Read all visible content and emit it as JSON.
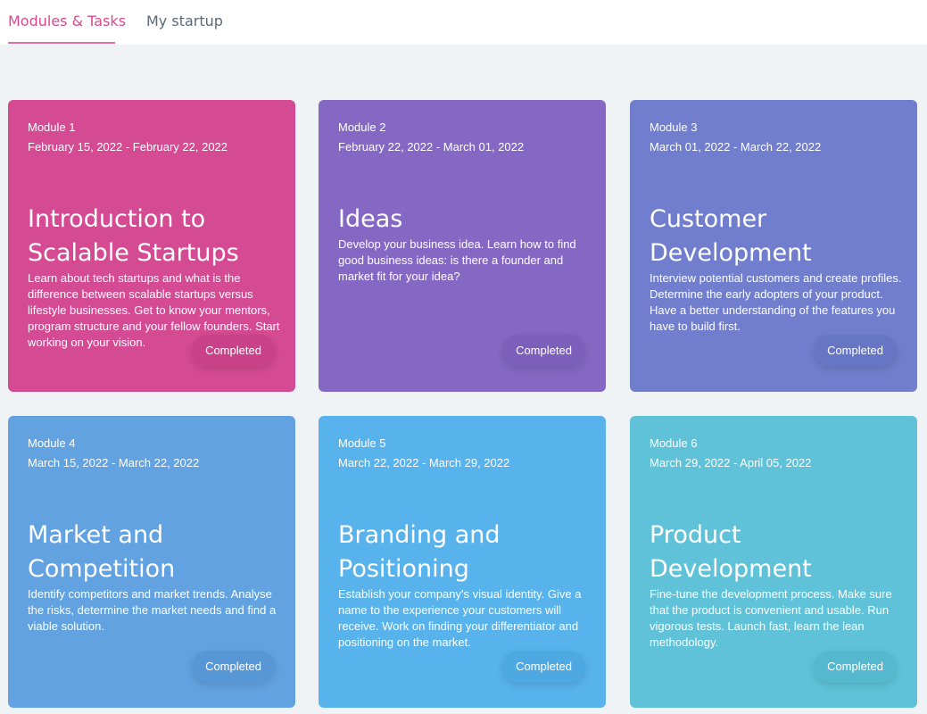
{
  "nav": {
    "tabs": [
      {
        "label": "Modules & Tasks"
      },
      {
        "label": "My startup"
      }
    ]
  },
  "modules": [
    {
      "module": "Module 1",
      "dates": "February 15, 2022 - February 22, 2022",
      "title": "Introduction to Scalable Startups",
      "description": "Learn about tech startups and what is the difference between scalable startups versus lifestyle businesses. Get to know your mentors, program structure and your fellow founders. Start working on your vision.",
      "status": "Completed",
      "color": "#d44a93",
      "badge_color": "#c94289"
    },
    {
      "module": "Module 2",
      "dates": "February 22, 2022 - March 01, 2022",
      "title": "Ideas",
      "description": "Develop your business idea. Learn how to find good business ideas: is there a founder and market fit for your idea?",
      "status": "Completed",
      "color": "#8468c4",
      "badge_color": "#7b5fbb"
    },
    {
      "module": "Module 3",
      "dates": "March 01, 2022 - March 22, 2022",
      "title": "Customer Development",
      "description": "Interview potential customers and create profiles. Determine the early adopters of your product. Have a better understanding of the features you have to build first.",
      "status": "Completed",
      "color": "#707ecd",
      "badge_color": "#6675c4"
    },
    {
      "module": "Module 4",
      "dates": "March 15, 2022 - March 22, 2022",
      "title": "Market and Competition",
      "description": "Identify competitors and market trends. Analyse the risks, determine the market needs and find a viable solution.",
      "status": "Completed",
      "color": "#62a2e0",
      "badge_color": "#5897d6"
    },
    {
      "module": "Module 5",
      "dates": "March 22, 2022 - March 29, 2022",
      "title": "Branding and Positioning",
      "description": "Establish your company's visual identity. Give a name to the experience your customers will receive. Work on finding your differentiator and positioning on the market.",
      "status": "Completed",
      "color": "#58b2ec",
      "badge_color": "#4ea8e2"
    },
    {
      "module": "Module 6",
      "dates": "March 29, 2022 - April 05, 2022",
      "title": "Product Development",
      "description": "Fine-tune the development process. Make sure that the product is convenient and usable. Run vigorous tests. Launch fast, learn the lean methodology.",
      "status": "Completed",
      "color": "#5fc2d8",
      "badge_color": "#55b8ce"
    }
  ]
}
